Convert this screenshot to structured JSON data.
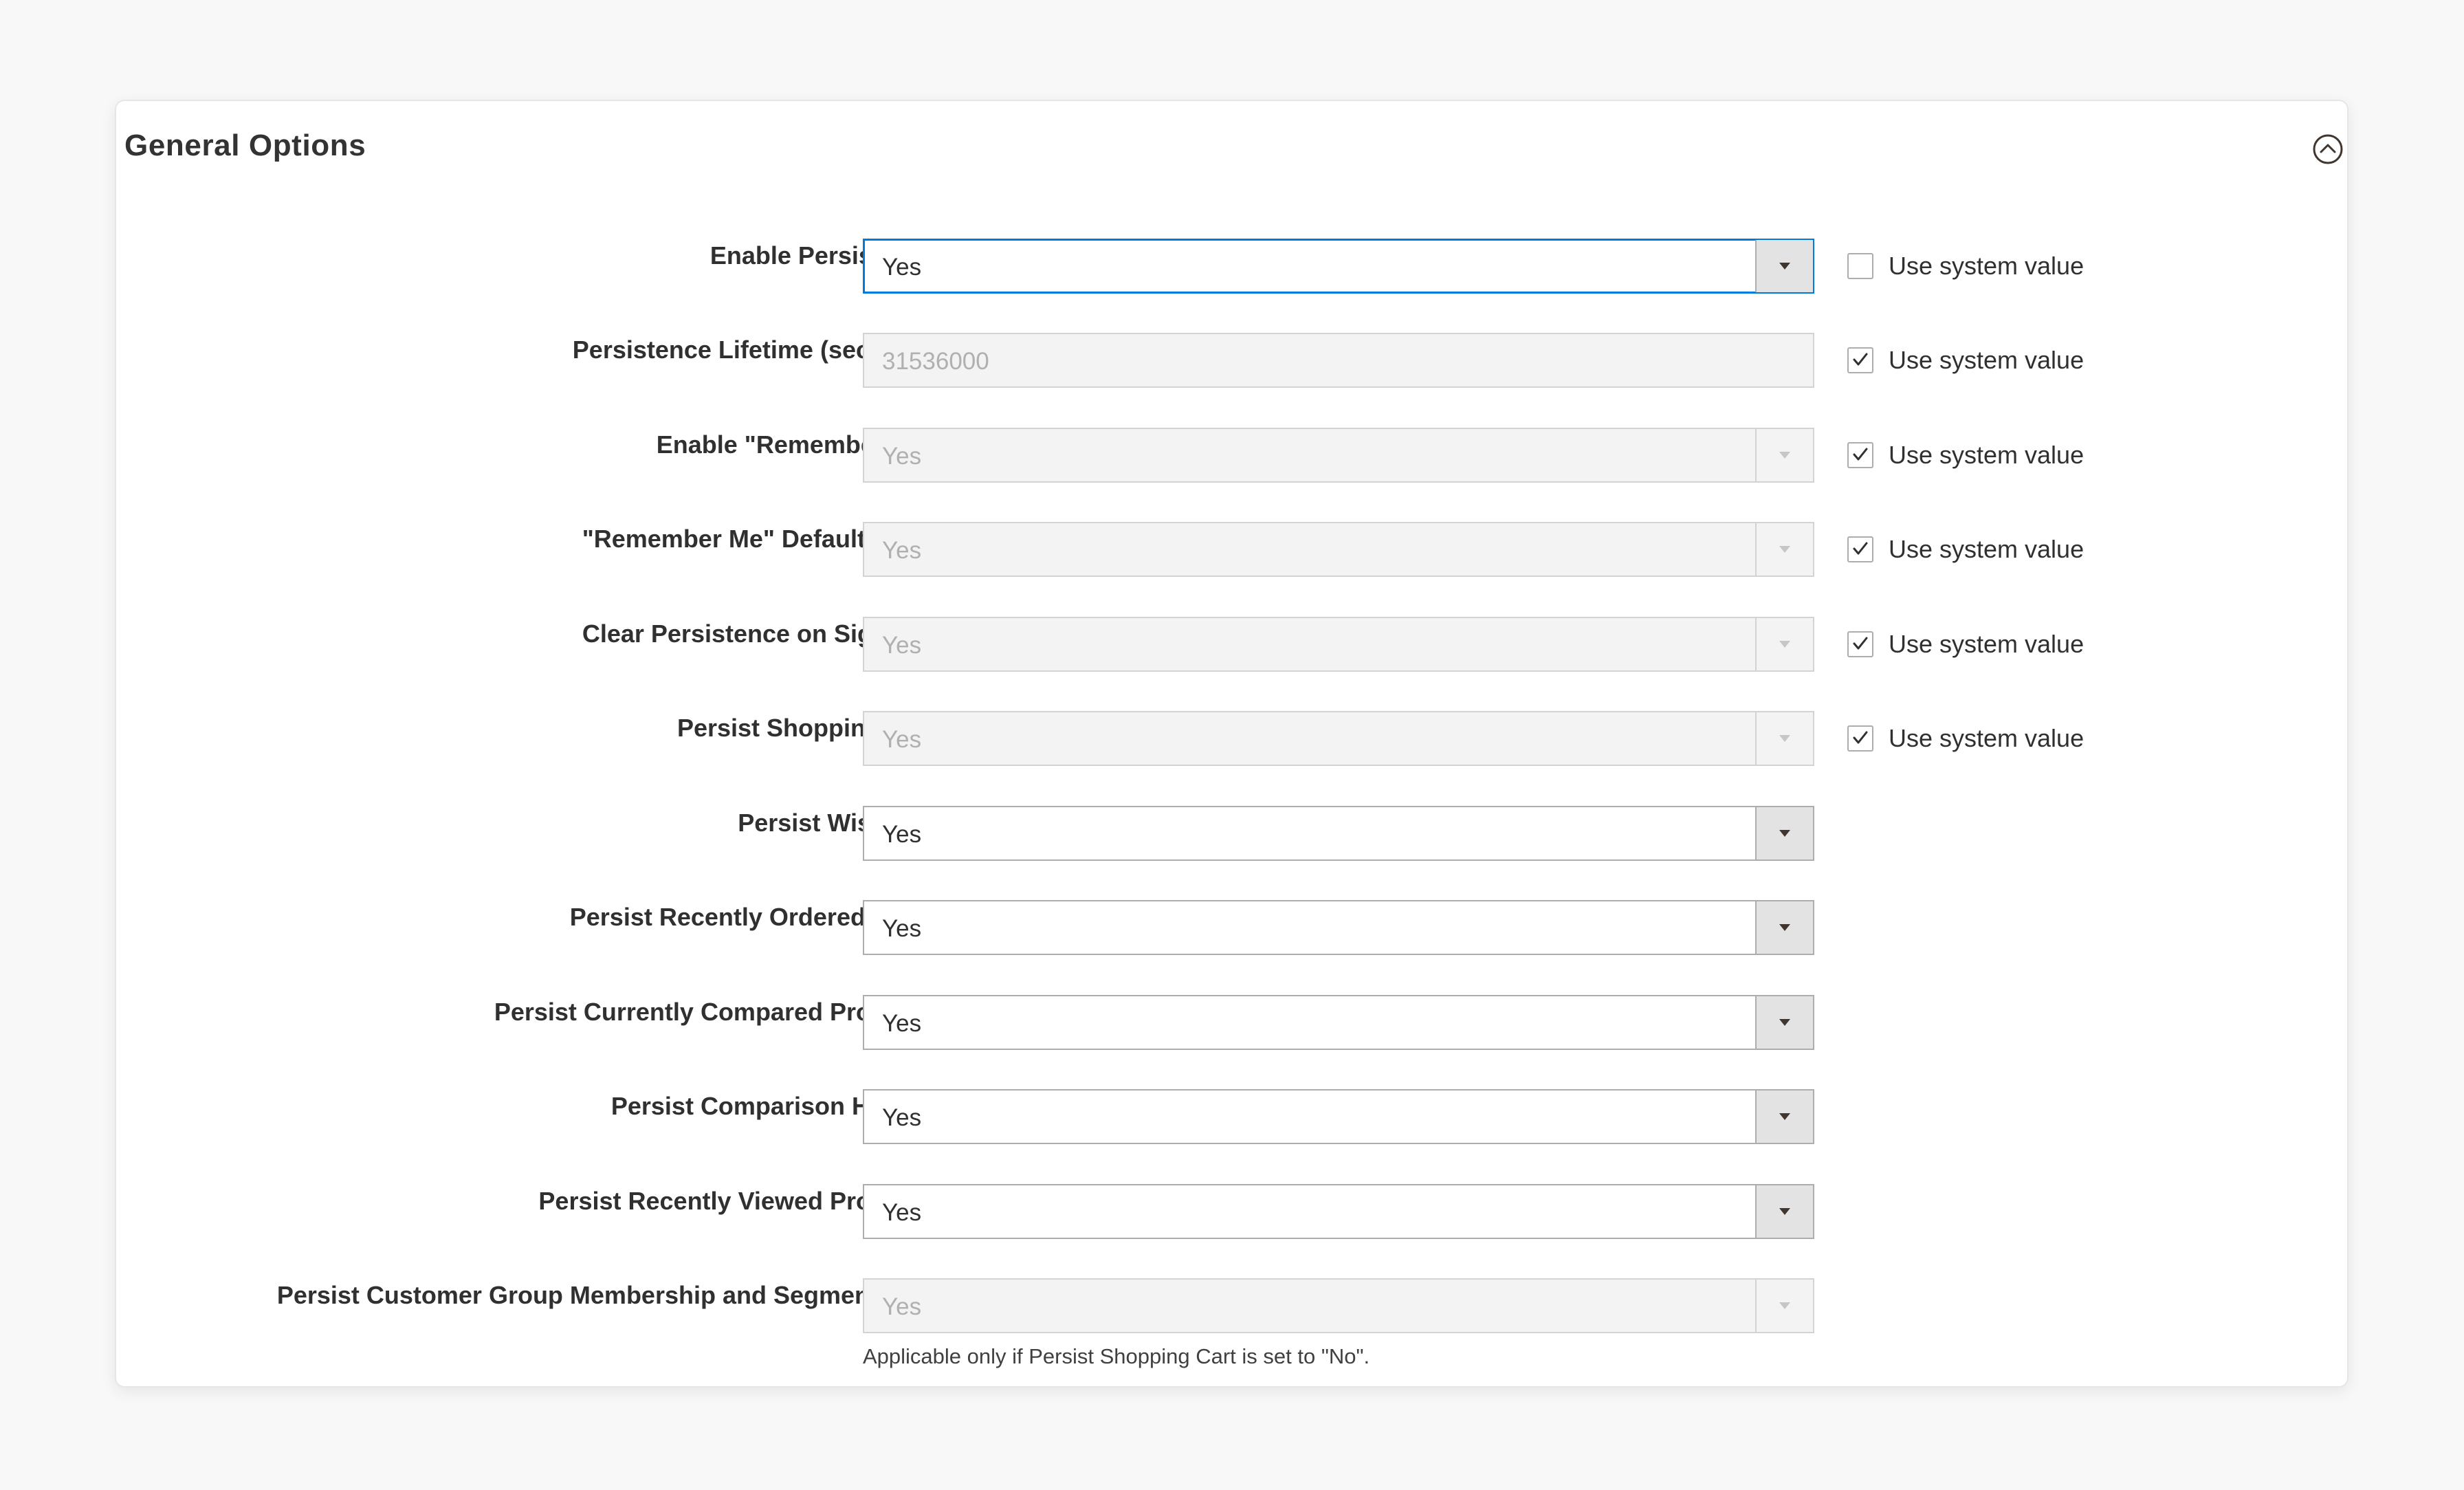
{
  "section": {
    "title": "General Options",
    "collapse_icon": "chevron-up-circle-icon"
  },
  "system_value_label": "Use system value",
  "rows": [
    {
      "label": "Enable Persistence",
      "type": "select",
      "value": "Yes",
      "state": "focused",
      "use_system_value": false,
      "show_system_value": true
    },
    {
      "label": "Persistence Lifetime (seconds)",
      "type": "text",
      "value": "31536000",
      "state": "disabled",
      "use_system_value": true,
      "show_system_value": true
    },
    {
      "label": "Enable \"Remember Me\"",
      "type": "select",
      "value": "Yes",
      "state": "disabled",
      "use_system_value": true,
      "show_system_value": true
    },
    {
      "label": "\"Remember Me\" Default Value",
      "type": "select",
      "value": "Yes",
      "state": "disabled",
      "use_system_value": true,
      "show_system_value": true
    },
    {
      "label": "Clear Persistence on Sign Out",
      "type": "select",
      "value": "Yes",
      "state": "disabled",
      "use_system_value": true,
      "show_system_value": true
    },
    {
      "label": "Persist Shopping Cart",
      "type": "select",
      "value": "Yes",
      "state": "disabled",
      "use_system_value": true,
      "show_system_value": true
    },
    {
      "label": "Persist Wish List",
      "type": "select",
      "value": "Yes",
      "state": "enabled",
      "use_system_value": false,
      "show_system_value": false
    },
    {
      "label": "Persist Recently Ordered Items",
      "type": "select",
      "value": "Yes",
      "state": "enabled",
      "use_system_value": false,
      "show_system_value": false
    },
    {
      "label": "Persist Currently Compared Products",
      "type": "select",
      "value": "Yes",
      "state": "enabled",
      "use_system_value": false,
      "show_system_value": false
    },
    {
      "label": "Persist Comparison History",
      "type": "select",
      "value": "Yes",
      "state": "enabled",
      "use_system_value": false,
      "show_system_value": false
    },
    {
      "label": "Persist Recently Viewed Products",
      "type": "select",
      "value": "Yes",
      "state": "enabled",
      "use_system_value": false,
      "show_system_value": false
    },
    {
      "label": "Persist Customer Group Membership and Segmentation",
      "type": "select",
      "value": "Yes",
      "state": "disabled",
      "use_system_value": false,
      "show_system_value": false,
      "note": "Applicable only if Persist Shopping Cart is set to \"No\"."
    }
  ],
  "colors": {
    "focus_border": "#007bdb",
    "border": "#adadad",
    "disabled_bg": "#f3f3f3",
    "page_bg": "#f8f8f8"
  }
}
